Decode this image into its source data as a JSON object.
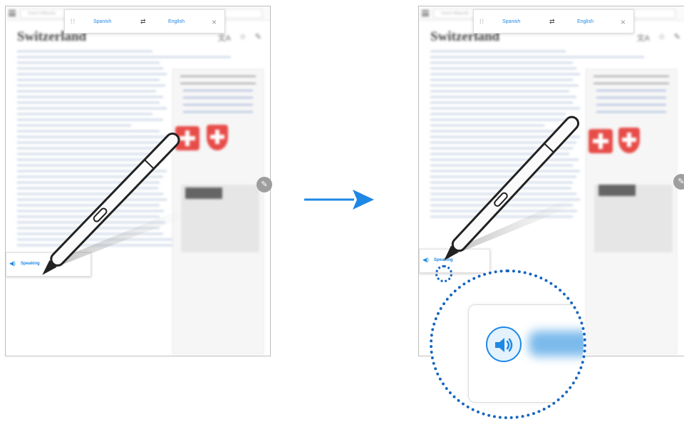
{
  "toolbar": {
    "from_language": "Spanish",
    "to_language": "English",
    "swap_icon": "swap-arrows",
    "close_icon": "close-x"
  },
  "article": {
    "title": "Switzerland",
    "header_icons": [
      "translate-icon",
      "star-icon",
      "edit-icon"
    ]
  },
  "search": {
    "placeholder": "Search Wikipedia"
  },
  "selection_label": {
    "word": "Speaking",
    "icon": "speaker-icon"
  },
  "colors": {
    "accent": "#1e88e5",
    "arrow": "#1e88e5",
    "callout_dots": "#1565c0",
    "flag_red": "#e53935"
  },
  "zoom": {
    "icon": "speaker-icon"
  }
}
